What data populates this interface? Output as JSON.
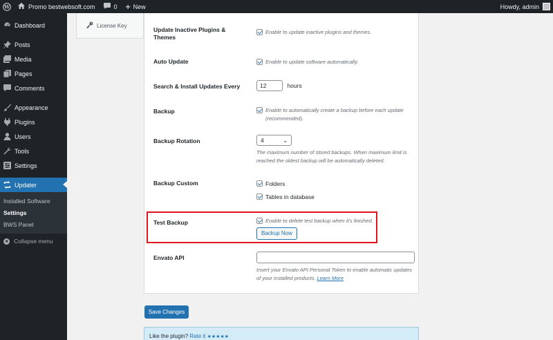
{
  "admin_bar": {
    "site_name": "Promo bestwebsoft.com",
    "comments_count": "0",
    "new_label": "New",
    "greeting": "Howdy, admin"
  },
  "sidebar": {
    "items": [
      {
        "label": "Dashboard",
        "icon": "dashboard-icon"
      },
      {
        "label": "Posts",
        "icon": "pin-icon"
      },
      {
        "label": "Media",
        "icon": "media-icon"
      },
      {
        "label": "Pages",
        "icon": "pages-icon"
      },
      {
        "label": "Comments",
        "icon": "comments-icon"
      },
      {
        "label": "Appearance",
        "icon": "brush-icon"
      },
      {
        "label": "Plugins",
        "icon": "plug-icon"
      },
      {
        "label": "Users",
        "icon": "users-icon"
      },
      {
        "label": "Tools",
        "icon": "wrench-icon"
      },
      {
        "label": "Settings",
        "icon": "settings-icon"
      },
      {
        "label": "Updater",
        "icon": "update-icon"
      }
    ],
    "submenu": [
      "Installed Software",
      "Settings",
      "BWS Panel"
    ],
    "collapse_label": "Collapse menu"
  },
  "tabs": {
    "license_key": "License Key"
  },
  "settings": {
    "update_inactive": {
      "label": "Update Inactive Plugins & Themes",
      "desc": "Enable to update inactive plugins and themes."
    },
    "auto_update": {
      "label": "Auto Update",
      "desc": "Enable to update software automatically."
    },
    "search_install": {
      "label": "Search & Install Updates Every",
      "value": "12",
      "unit": "hours"
    },
    "backup": {
      "label": "Backup",
      "desc": "Enable to automatically create a backup before each update (recommended)."
    },
    "backup_rotation": {
      "label": "Backup Rotation",
      "value": "4",
      "desc": "The maximum number of stored backups. When maximum limit is reached the oldest backup will be automatically deleted."
    },
    "backup_custom": {
      "label": "Backup Custom",
      "opt1": "Folders",
      "opt2": "Tables in database"
    },
    "test_backup": {
      "label": "Test Backup",
      "desc": "Enable to delete test backup when it's finished.",
      "button": "Backup Now"
    },
    "envato_api": {
      "label": "Envato API",
      "value": "",
      "desc": "Insert your Envato API Personal Token to enable automatic updates of your installed products.",
      "link": "Learn More"
    }
  },
  "save_button": "Save Changes",
  "rate": {
    "text": "Like the plugin?",
    "link": "Rate it",
    "stars": "★★★★★"
  },
  "colors": {
    "accent": "#2271b1",
    "highlight_box": "#e0141e"
  }
}
